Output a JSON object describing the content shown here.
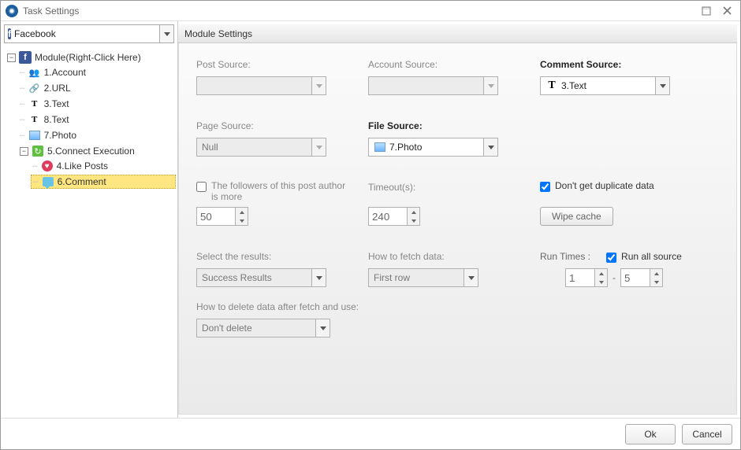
{
  "window": {
    "title": "Task Settings"
  },
  "left": {
    "platform_selected": "Facebook",
    "root_label": "Module(Right-Click Here)",
    "nodes": {
      "account": "1.Account",
      "url": "2.URL",
      "text3": "3.Text",
      "text8": "8.Text",
      "photo": "7.Photo",
      "connect": "5.Connect Execution",
      "like": "4.Like Posts",
      "comment": "6.Comment"
    }
  },
  "right": {
    "header": "Module Settings",
    "labels": {
      "post_source": "Post Source:",
      "account_source": "Account Source:",
      "comment_source": "Comment Source:",
      "page_source": "Page Source:",
      "file_source": "File Source:",
      "timeout": "Timeout(s):",
      "followers": "The followers of this post author is more",
      "nodup": "Don't get duplicate data",
      "wipe": "Wipe cache",
      "select_results": "Select the results:",
      "how_fetch": "How to fetch data:",
      "run_times": "Run Times :",
      "run_all": "Run all source",
      "how_delete": "How to delete data after fetch and use:"
    },
    "values": {
      "comment_source": "3.Text",
      "page_source": "Null",
      "file_source": "7.Photo",
      "followers_min": "50",
      "timeout": "240",
      "select_results": "Success Results",
      "how_fetch": "First row",
      "run_from": "1",
      "run_to": "5",
      "how_delete": "Don't delete"
    },
    "checked": {
      "nodup": true,
      "run_all": true,
      "followers": false
    }
  },
  "footer": {
    "ok": "Ok",
    "cancel": "Cancel"
  }
}
